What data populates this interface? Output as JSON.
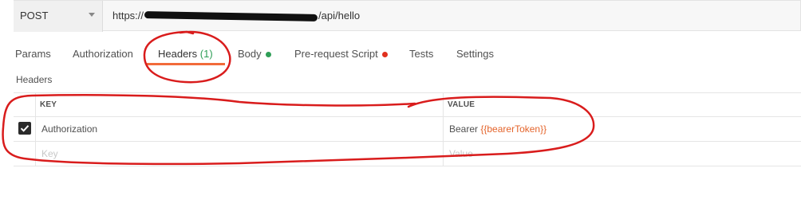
{
  "request": {
    "method": "POST",
    "url_prefix": "https://",
    "url_suffix": "/api/hello"
  },
  "tabs": [
    {
      "label": "Params"
    },
    {
      "label": "Authorization"
    },
    {
      "label": "Headers",
      "count": "(1)",
      "active": true
    },
    {
      "label": "Body",
      "indicator": "#2f9e57"
    },
    {
      "label": "Pre-request Script",
      "indicator": "#e0301e"
    },
    {
      "label": "Tests"
    },
    {
      "label": "Settings"
    }
  ],
  "headers_section": {
    "title": "Headers",
    "columns": {
      "key": "KEY",
      "value": "VALUE"
    },
    "rows": [
      {
        "enabled": true,
        "key": "Authorization",
        "value_prefix": "Bearer ",
        "value_variable": "{{bearerToken}}"
      }
    ],
    "new_row": {
      "key_placeholder": "Key",
      "value_placeholder": "Value"
    }
  },
  "colors": {
    "accent": "#f26b3a",
    "variable": "#e4642b",
    "annotation": "#d91c1c"
  }
}
